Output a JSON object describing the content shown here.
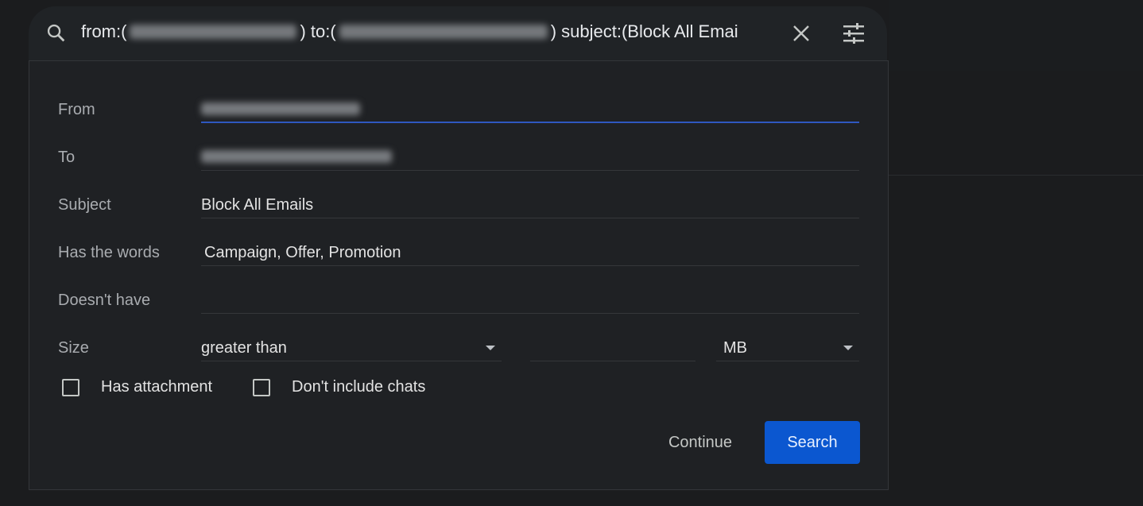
{
  "search": {
    "query_from_prefix": "from:(",
    "query_to_prefix": ") to:(",
    "query_subject": ") subject:(Block All Emai"
  },
  "form": {
    "from": {
      "label": "From"
    },
    "to": {
      "label": "To"
    },
    "subject": {
      "label": "Subject",
      "value": "Block All Emails"
    },
    "has_words": {
      "label": "Has the words",
      "value": "Campaign, Offer, Promotion"
    },
    "doesnt_have": {
      "label": "Doesn't have",
      "value": ""
    },
    "size": {
      "label": "Size",
      "comparator": "greater than",
      "value": "",
      "unit": "MB"
    },
    "has_attachment": {
      "label": "Has attachment",
      "checked": false
    },
    "dont_include_chats": {
      "label": "Don't include chats",
      "checked": false
    }
  },
  "buttons": {
    "continue": "Continue",
    "search": "Search"
  },
  "colors": {
    "accent": "#0b57d0",
    "focus_underline": "#2f58c0"
  }
}
